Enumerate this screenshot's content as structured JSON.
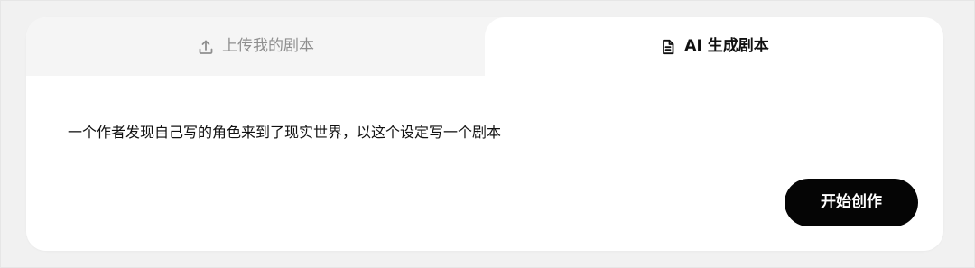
{
  "tabs": {
    "upload": {
      "label": "上传我的剧本",
      "icon": "upload-icon"
    },
    "ai_generate": {
      "label": "AI 生成剧本",
      "icon": "document-icon",
      "selected": true
    }
  },
  "prompt": {
    "text": "一个作者发现自己写的角色来到了现实世界，以这个设定写一个剧本"
  },
  "actions": {
    "start_label": "开始创作"
  }
}
